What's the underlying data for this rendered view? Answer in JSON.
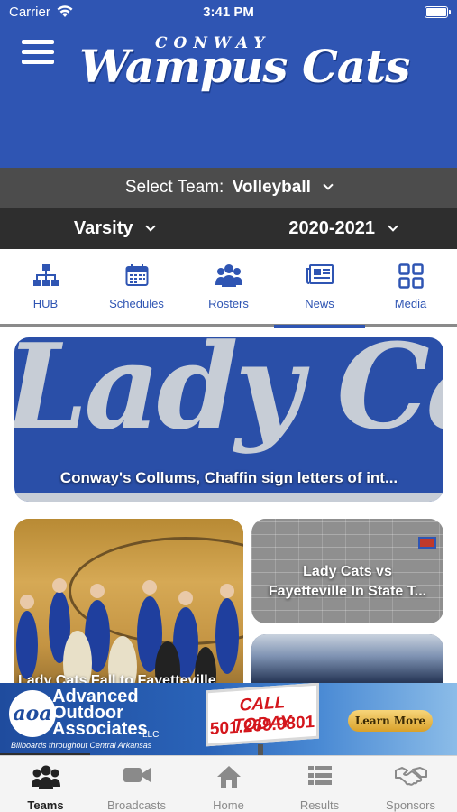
{
  "status_bar": {
    "carrier": "Carrier",
    "time": "3:41 PM"
  },
  "header": {
    "logo_top": "CONWAY",
    "logo_main": "Wampus Cats"
  },
  "team_selector": {
    "label": "Select Team:",
    "value": "Volleyball"
  },
  "level_selector": {
    "level": "Varsity",
    "season": "2020-2021"
  },
  "tabs": [
    {
      "label": "HUB",
      "icon": "hierarchy-icon"
    },
    {
      "label": "Schedules",
      "icon": "calendar-icon"
    },
    {
      "label": "Rosters",
      "icon": "people-icon"
    },
    {
      "label": "News",
      "icon": "newspaper-icon"
    },
    {
      "label": "Media",
      "icon": "grid-icon"
    }
  ],
  "active_tab": "News",
  "news": [
    {
      "title": "Conway's Collums, Chaffin sign letters of int...",
      "image_text": "Lady Ca"
    },
    {
      "title": "Lady Cats Fall to Fayetteville"
    },
    {
      "title_line1": "Lady Cats vs",
      "title_line2": "Fayetteville In State T..."
    },
    {
      "title": ""
    }
  ],
  "ad": {
    "company_line1": "Advanced",
    "company_line2": "Outdoor",
    "company_line3": "Associates",
    "llc": "LLC",
    "logo_text": "aoa",
    "tagline": "Billboards throughout Central Arkansas",
    "call": "CALL TODAY",
    "phone": "501.269.9801",
    "cta": "Learn More"
  },
  "bottom_tabs": [
    {
      "label": "Teams",
      "icon": "team-icon",
      "active": true
    },
    {
      "label": "Broadcasts",
      "icon": "video-camera-icon",
      "active": false
    },
    {
      "label": "Home",
      "icon": "home-icon",
      "active": false
    },
    {
      "label": "Results",
      "icon": "list-icon",
      "active": false
    },
    {
      "label": "Sponsors",
      "icon": "handshake-icon",
      "active": false
    }
  ],
  "colors": {
    "brand_blue": "#2f55b3",
    "dark_bar": "#2e2e2e",
    "mid_bar": "#4c4c4c"
  }
}
